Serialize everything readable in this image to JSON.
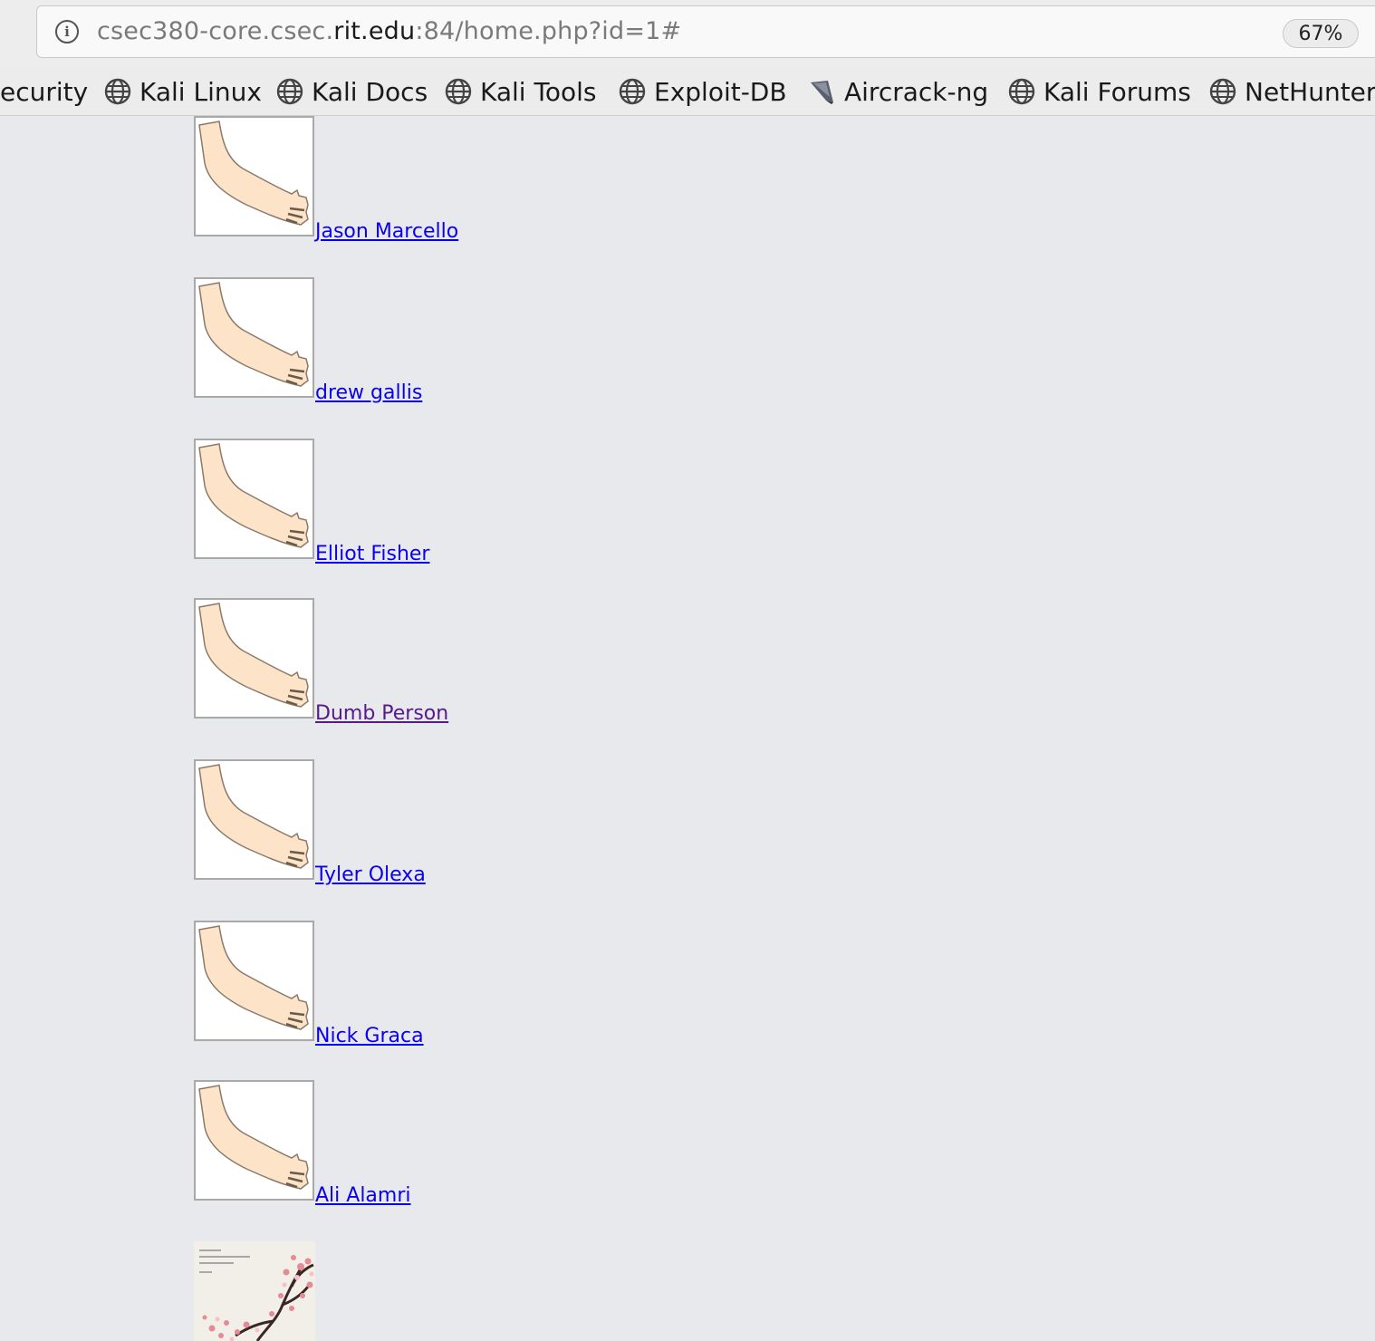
{
  "browser": {
    "url_prefix": "csec380-core.csec.",
    "url_host": "rit.edu",
    "url_suffix": ":84/home.php?id=1#",
    "zoom": "67%"
  },
  "bookmarks": [
    {
      "label": "ecurity"
    },
    {
      "label": "Kali Linux"
    },
    {
      "label": "Kali Docs"
    },
    {
      "label": "Kali Tools"
    },
    {
      "label": "Exploit-DB"
    },
    {
      "label": "Aircrack-ng"
    },
    {
      "label": "Kali Forums"
    },
    {
      "label": "NetHunter"
    }
  ],
  "users": [
    {
      "name": "Jason Marcello"
    },
    {
      "name": "drew gallis"
    },
    {
      "name": "Elliot Fisher"
    },
    {
      "name": "Dumb Person"
    },
    {
      "name": "Tyler Olexa"
    },
    {
      "name": "Nick Graca"
    },
    {
      "name": "Ali Alamri"
    }
  ]
}
